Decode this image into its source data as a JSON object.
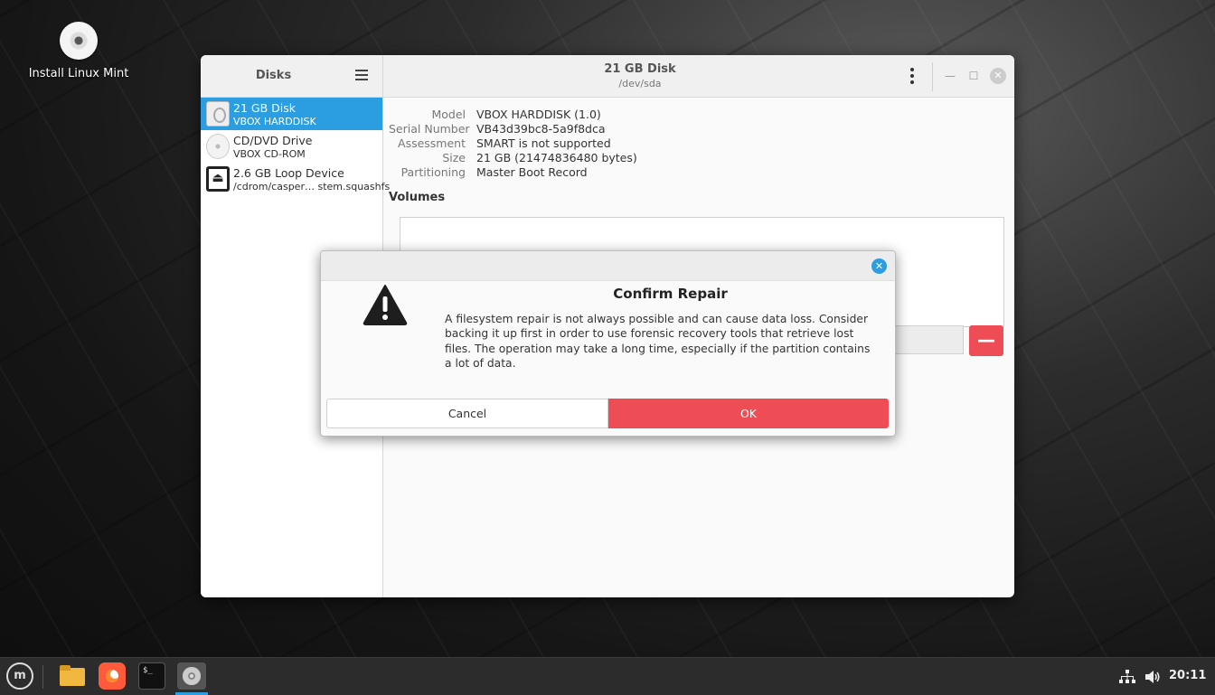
{
  "desktop": {
    "icon_label": "Install Linux Mint"
  },
  "sidebar": {
    "title": "Disks",
    "items": [
      {
        "name": "21 GB Disk",
        "sub": "VBOX HARDDISK",
        "icon": "hdd-icon",
        "selected": true
      },
      {
        "name": "CD/DVD Drive",
        "sub": "VBOX CD-ROM",
        "icon": "cdrom-icon",
        "selected": false
      },
      {
        "name": "2.6 GB Loop Device",
        "sub": "/cdrom/casper… stem.squashfs",
        "icon": "eject-icon",
        "selected": false
      }
    ]
  },
  "header": {
    "title": "21 GB Disk",
    "subtitle": "/dev/sda"
  },
  "details": {
    "model_label": "Model",
    "model": "VBOX HARDDISK (1.0)",
    "serial_label": "Serial Number",
    "serial": "VB43d39bc8-5a9f8dca",
    "assessment_label": "Assessment",
    "assessment": "SMART is not supported",
    "size_label": "Size",
    "size": "21 GB (21474836480 bytes)",
    "partitioning_label": "Partitioning",
    "partitioning": "Master Boot Record"
  },
  "volumes": {
    "title": "Volumes",
    "minus_label": "—"
  },
  "dialog": {
    "title": "Confirm Repair",
    "body": "A filesystem repair is not always possible and can cause data loss. Consider backing it up first in order to use forensic recovery tools that retrieve lost files. The operation may take a long time, especially if the partition contains a lot of data.",
    "cancel_label": "Cancel",
    "ok_label": "OK"
  },
  "taskbar": {
    "terminal_glyph": "$_",
    "clock": "20:11"
  },
  "colors": {
    "accent": "#2a9ee0",
    "destructive": "#ef4d55"
  }
}
